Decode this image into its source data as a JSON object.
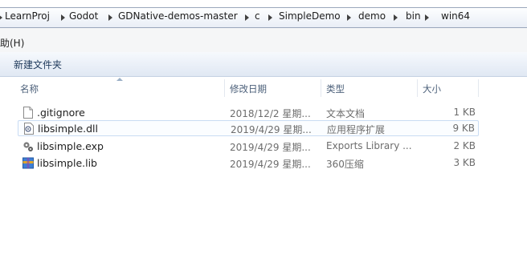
{
  "breadcrumbs": [
    "LearnProj",
    "Godot",
    "GDNative-demos-master",
    "c",
    "SimpleDemo",
    "demo",
    "bin",
    "win64"
  ],
  "menu": {
    "help_label": "帮助(H)"
  },
  "commands": {
    "new_folder": "新建文件夹"
  },
  "columns": {
    "name": "名称",
    "date": "修改日期",
    "type": "类型",
    "size": "大小"
  },
  "files": [
    {
      "name": ".gitignore",
      "date": "2018/12/2 星期...",
      "type": "文本文档",
      "size": "1 KB",
      "icon": "text-file-icon"
    },
    {
      "name": "libsimple.dll",
      "date": "2019/4/29 星期...",
      "type": "应用程序扩展",
      "size": "9 KB",
      "icon": "dll-file-icon",
      "selected": true
    },
    {
      "name": "libsimple.exp",
      "date": "2019/4/29 星期...",
      "type": "Exports Library ...",
      "size": "2 KB",
      "icon": "exp-file-icon"
    },
    {
      "name": "libsimple.lib",
      "date": "2019/4/29 星期...",
      "type": "360压缩",
      "size": "3 KB",
      "icon": "archive-file-icon"
    }
  ]
}
